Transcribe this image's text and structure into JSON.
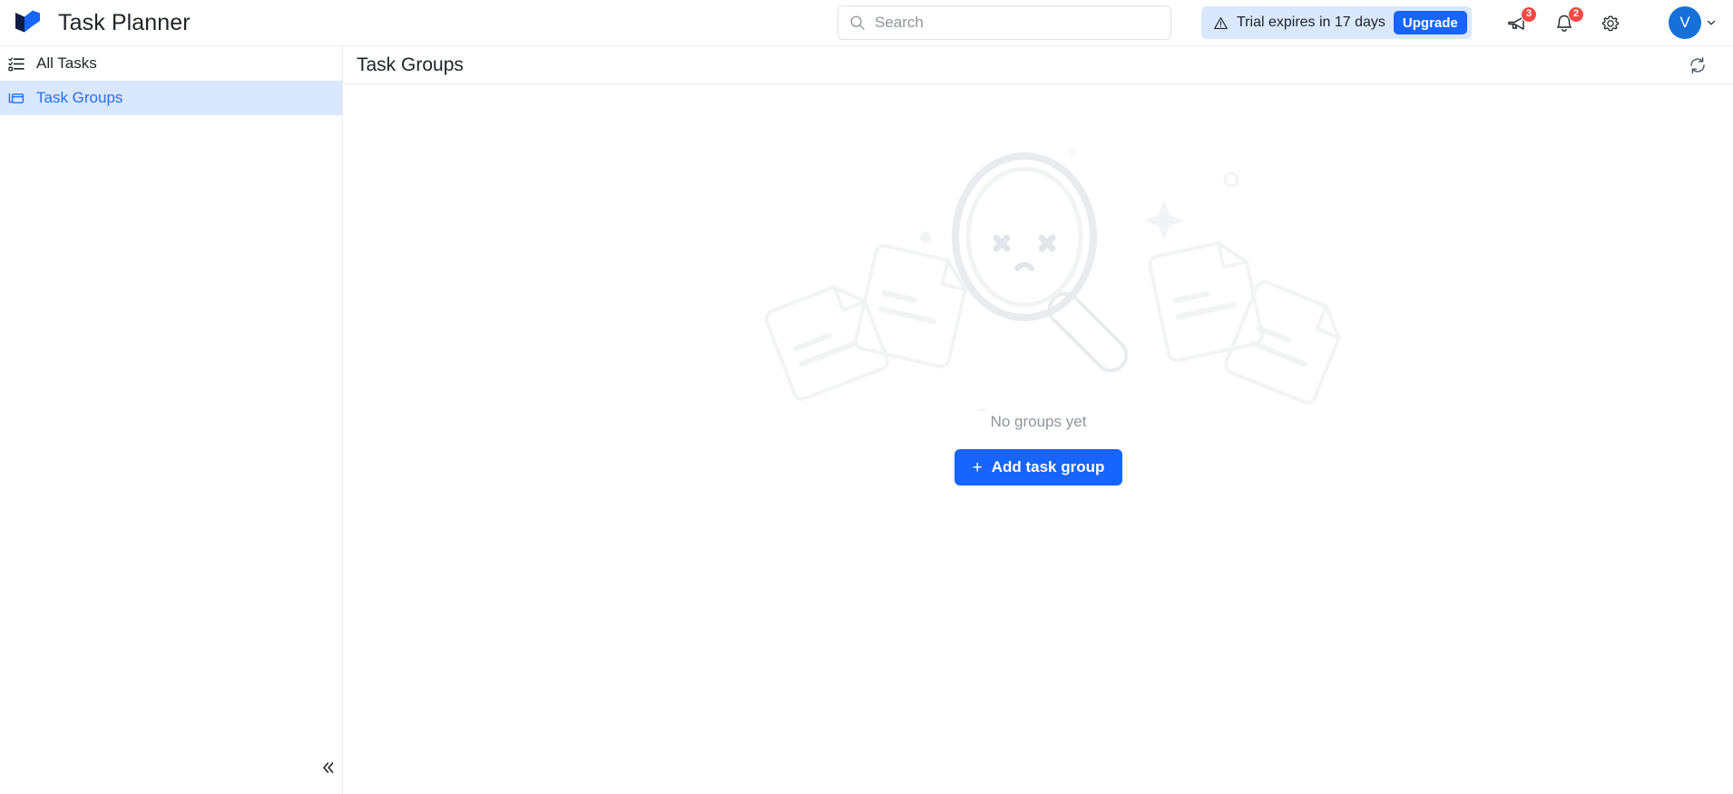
{
  "app": {
    "title": "Task Planner",
    "logo_icon": "cube-logo-icon",
    "brand_color_dark": "#0f1d40",
    "brand_color_light": "#1764ff"
  },
  "search": {
    "placeholder": "Search",
    "value": "",
    "icon": "search-icon"
  },
  "trial": {
    "icon": "warning-triangle-icon",
    "message": "Trial expires in 17 days",
    "upgrade_label": "Upgrade",
    "background": "#d9e7ff",
    "button_color": "#1764ff"
  },
  "header_icons": {
    "announcements": {
      "icon": "megaphone-icon",
      "badge": "3"
    },
    "notifications": {
      "icon": "bell-icon",
      "badge": "2"
    },
    "settings": {
      "icon": "gear-icon"
    },
    "badge_color": "#f54a45"
  },
  "user": {
    "initial": "V",
    "avatar_color": "#1570d9",
    "chevron": "chevron-down-icon"
  },
  "sidebar": {
    "items": [
      {
        "label": "All Tasks",
        "icon": "task-list-icon",
        "active": false
      },
      {
        "label": "Task Groups",
        "icon": "folders-icon",
        "active": true
      }
    ],
    "collapse_icon": "chevron-double-left-icon",
    "active_background": "#d9e7ff",
    "active_color": "#2b6cf6"
  },
  "content": {
    "title": "Task Groups",
    "refresh_icon": "refresh-icon",
    "empty_state": {
      "illustration": "sad-magnifier-no-results-icon",
      "message": "No groups yet",
      "cta_label": "Add task group",
      "cta_plus": "+",
      "cta_color": "#1764ff"
    }
  }
}
